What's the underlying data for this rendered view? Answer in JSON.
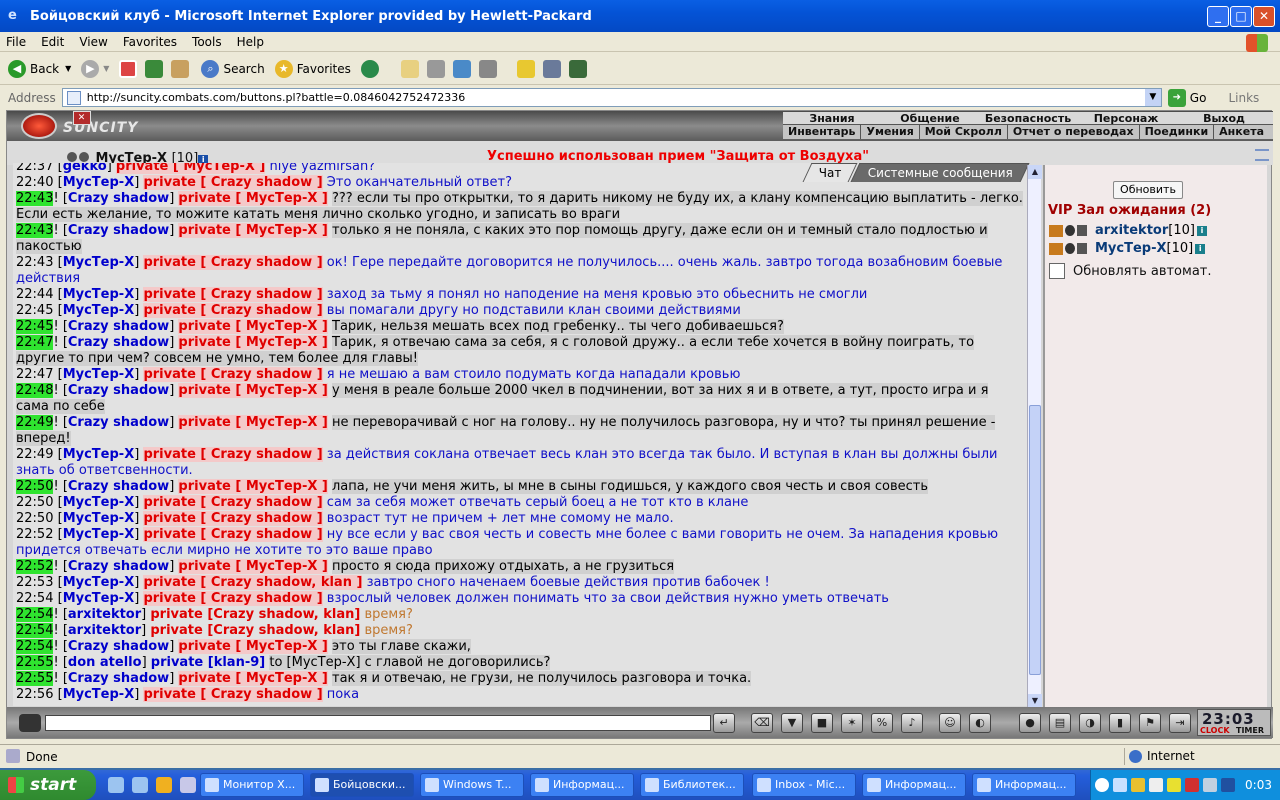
{
  "window": {
    "title": "Бойцовский клуб - Microsoft Internet Explorer provided by Hewlett-Packard"
  },
  "menu": [
    "File",
    "Edit",
    "View",
    "Favorites",
    "Tools",
    "Help"
  ],
  "toolbar": {
    "back": "Back",
    "search": "Search",
    "favorites": "Favorites"
  },
  "address": {
    "label": "Address",
    "url": "http://suncity.combats.com/buttons.pl?battle=0.0846042752472336",
    "go": "Go",
    "links": "Links"
  },
  "site": {
    "logo": "SUNCITY",
    "nav_top": [
      "Знания",
      "Общение",
      "Безопасность",
      "Персонаж",
      "Выход"
    ],
    "nav_bottom": [
      "Инвентарь",
      "Умения",
      "Мой Скролл",
      "Отчет о переводах",
      "Поединки",
      "Анкета"
    ],
    "char_name": "МусТер-Х",
    "char_level": "[10]",
    "success": "Успешно использован прием \"Защита от Воздуха\"",
    "tabs": {
      "chat": "Чат",
      "system": "Системные сообщения"
    }
  },
  "chat": [
    {
      "time": "22:37",
      "g": false,
      "sender": "gekko",
      "pv": "private [ МусТер-Х ]",
      "text": "niye yazmirsan?",
      "cls": "tx"
    },
    {
      "time": "22:40",
      "g": false,
      "sender": "МусТер-Х",
      "pv": "private [ Crazy shadow ]",
      "text": "Это оканчательный ответ?",
      "cls": "tx"
    },
    {
      "time": "22:43",
      "g": true,
      "sender": "Crazy shadow",
      "pv": "private [ МусТер-Х ]",
      "text": "??? если ты про открытки, то я дарить никому не буду их, а клану компенсацию выплатить - легко. Если есть желание, то можите катать меня лично сколько угодно, и записать во враги",
      "cls": "tx2"
    },
    {
      "time": "22:43",
      "g": true,
      "sender": "Crazy shadow",
      "pv": "private [ МусТер-Х ]",
      "text": "только я не поняла, с каких это пор помощь другу, даже если он и темный стало подлостью и пакостью",
      "cls": "tx2"
    },
    {
      "time": "22:43",
      "g": false,
      "sender": "МусТер-Х",
      "pv": "private [ Crazy shadow ]",
      "text": "ок! Гере передайте договорится не получилось.... очень жаль. завтро тогода возабновим боевые действия",
      "cls": "tx"
    },
    {
      "time": "22:44",
      "g": false,
      "sender": "МусТер-Х",
      "pv": "private [ Crazy shadow ]",
      "text": "заход за тьму я понял но наподение на меня кровью это обьеснить не смогли",
      "cls": "tx"
    },
    {
      "time": "22:45",
      "g": false,
      "sender": "МусТер-Х",
      "pv": "private [ Crazy shadow ]",
      "text": "вы помагали другу но подставили клан своими действиями",
      "cls": "tx"
    },
    {
      "time": "22:45",
      "g": true,
      "sender": "Crazy shadow",
      "pv": "private [ МусТер-Х ]",
      "text": "Тарик, нельзя мешать всех под гребенку.. ты чего добиваешься?",
      "cls": "tx2"
    },
    {
      "time": "22:47",
      "g": true,
      "sender": "Crazy shadow",
      "pv": "private [ МусТер-Х ]",
      "text": "Тарик, я отвечаю сама за себя, я с головой дружу.. а если тебе хочется в войну поиграть, то другие то при чем? совсем не умно, тем более для главы!",
      "cls": "tx2"
    },
    {
      "time": "22:47",
      "g": false,
      "sender": "МусТер-Х",
      "pv": "private [ Crazy shadow ]",
      "text": "я не мешаю а вам стоило подумать когда нападали кровью",
      "cls": "tx"
    },
    {
      "time": "22:48",
      "g": true,
      "sender": "Crazy shadow",
      "pv": "private [ МусТер-Х ]",
      "text": "у меня в реале больше 2000 чкел в подчинении, вот за них я и в ответе, а тут, просто игра и я сама по себе",
      "cls": "tx2"
    },
    {
      "time": "22:49",
      "g": true,
      "sender": "Crazy shadow",
      "pv": "private [ МусТер-Х ]",
      "text": "не переворачивай с ног на голову.. ну не получилось разговора, ну и что? ты принял решение - вперед!",
      "cls": "tx2"
    },
    {
      "time": "22:49",
      "g": false,
      "sender": "МусТер-Х",
      "pv": "private [ Crazy shadow ]",
      "text": "за действия соклана отвечает весь клан это всегда так было. И вступая в клан вы должны были знать об ответсвенности.",
      "cls": "tx"
    },
    {
      "time": "22:50",
      "g": true,
      "sender": "Crazy shadow",
      "pv": "private [ МусТер-Х ]",
      "text": "лапа, не учи меня жить, ы мне в сыны годишься, у каждого своя честь и своя совесть",
      "cls": "tx2"
    },
    {
      "time": "22:50",
      "g": false,
      "sender": "МусТер-Х",
      "pv": "private [ Crazy shadow ]",
      "text": "сам за себя может отвечать серый боец а не тот кто в клане",
      "cls": "tx"
    },
    {
      "time": "22:50",
      "g": false,
      "sender": "МусТер-Х",
      "pv": "private [ Crazy shadow ]",
      "text": "возраст тут не причем + лет мне сомому не мало.",
      "cls": "tx"
    },
    {
      "time": "22:52",
      "g": false,
      "sender": "МусТер-Х",
      "pv": "private [ Crazy shadow ]",
      "text": "ну все если у вас своя честь и совесть мне более с вами говорить не очем. За нападения кровью придется отвечать если мирно не хотите то это ваше право",
      "cls": "tx"
    },
    {
      "time": "22:52",
      "g": true,
      "sender": "Crazy shadow",
      "pv": "private [ МусТер-Х ]",
      "text": "просто я сюда прихожу отдыхать, а не грузиться",
      "cls": "tx2"
    },
    {
      "time": "22:53",
      "g": false,
      "sender": "МусТер-Х",
      "pv": "private [ Crazy shadow, klan ]",
      "text": "завтро сного наченаем боевые действия против бабочек !",
      "cls": "tx"
    },
    {
      "time": "22:54",
      "g": false,
      "sender": "МусТер-Х",
      "pv": "private [ Crazy shadow ]",
      "text": "взрослый человек должен понимать что за свои действия нужно уметь отвечать",
      "cls": "tx"
    },
    {
      "time": "22:54",
      "g": true,
      "sender": "arxitektor",
      "pv": "private [Crazy shadow, klan]",
      "text": "время?",
      "cls": "tx3"
    },
    {
      "time": "22:54",
      "g": true,
      "sender": "arxitektor",
      "pv": "private [Crazy shadow, klan]",
      "text": "время?",
      "cls": "tx3"
    },
    {
      "time": "22:54",
      "g": true,
      "sender": "Crazy shadow",
      "pv": "private [ МусТер-Х ]",
      "text": "это ты главе скажи,",
      "cls": "tx2"
    },
    {
      "time": "22:55",
      "g": true,
      "sender": "don atello",
      "pv": "private [klan-9]",
      "text": "to [МусТер-Х] с главой не договорились?",
      "cls": "tx2"
    },
    {
      "time": "22:55",
      "g": true,
      "sender": "Crazy shadow",
      "pv": "private [ МусТер-Х ]",
      "text": "так я и отвечаю, не грузи, не получилось разговора и точка.",
      "cls": "tx2"
    },
    {
      "time": "22:56",
      "g": false,
      "sender": "МусТер-Х",
      "pv": "private [ Crazy shadow ]",
      "text": "пока",
      "cls": "tx"
    }
  ],
  "side": {
    "refresh": "Обновить",
    "vip": "VIP Зал ожидания (2)",
    "users": [
      {
        "name": "arxitektor",
        "level": "[10]"
      },
      {
        "name": "МусТер-Х",
        "level": "[10]"
      }
    ],
    "auto": "Обновлять автомат."
  },
  "clock": {
    "time": "23:03",
    "clock": "CLOCK",
    "timer": "TIMER"
  },
  "status": {
    "text": "Done",
    "zone": "Internet"
  },
  "taskbar": {
    "start": "start",
    "tasks": [
      "Монитор Х...",
      "Бойцовски...",
      "Windows T...",
      "Информац...",
      "Библиотек...",
      "Inbox - Mic...",
      "Информац...",
      "Информац..."
    ],
    "time": "0:03"
  }
}
